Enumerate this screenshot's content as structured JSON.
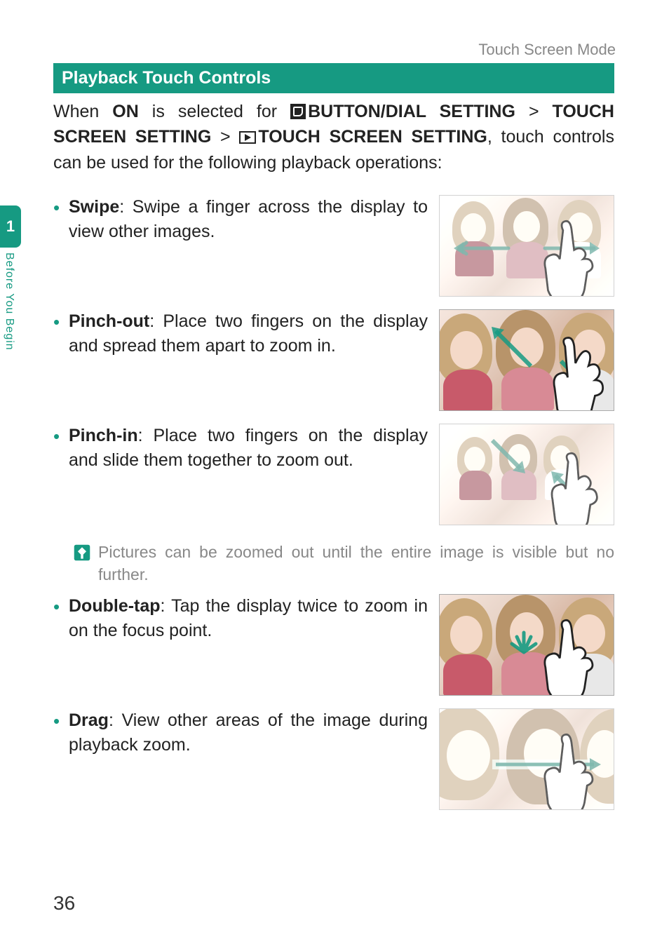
{
  "header": {
    "running_head": "Touch Screen Mode"
  },
  "sidebar": {
    "chapter_num": "1",
    "chapter_label": "Before You Begin"
  },
  "section": {
    "title": "Playback Touch Controls"
  },
  "intro": {
    "p1a": "When ",
    "on": "ON",
    "p1b": " is selected for ",
    "path1": "BUTTON/DIAL SETTING",
    "gt": ">",
    "path2": "TOUCH SCREEN SETTING",
    "path3": "TOUCH SCREEN SETTING",
    "p1c": ", touch controls can be used for the following playback operations:"
  },
  "items": [
    {
      "term": "Swipe",
      "desc": ": Swipe a finger across the display to view other images."
    },
    {
      "term": "Pinch-out",
      "desc": ": Place two fingers on the display and spread them apart to zoom in."
    },
    {
      "term": "Pinch-in",
      "desc": ": Place two fingers on the display and slide them together to zoom out."
    },
    {
      "term": "Double-tap",
      "desc": ": Tap the display twice to zoom in on the focus point."
    },
    {
      "term": "Drag",
      "desc": ": View other areas of the image during playback zoom."
    }
  ],
  "note": {
    "text": "Pictures can be zoomed out until the entire image is visible but no further."
  },
  "page_number": "36"
}
